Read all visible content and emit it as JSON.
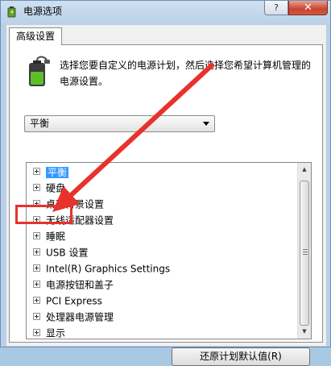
{
  "window": {
    "title": "电源选项",
    "help_label": "?",
    "close_label": "✕"
  },
  "tab": {
    "label": "高级设置"
  },
  "description": "选择您要自定义的电源计划，然后选择您希望计算机管理的电源设置。",
  "plan_select": {
    "value": "平衡"
  },
  "tree": {
    "items": [
      {
        "label": "平衡",
        "selected": true
      },
      {
        "label": "硬盘"
      },
      {
        "label": "桌面背景设置"
      },
      {
        "label": "无线适配器设置"
      },
      {
        "label": "睡眠"
      },
      {
        "label": "USB 设置"
      },
      {
        "label": "Intel(R) Graphics Settings"
      },
      {
        "label": "电源按钮和盖子"
      },
      {
        "label": "PCI Express"
      },
      {
        "label": "处理器电源管理"
      },
      {
        "label": "显示"
      }
    ]
  },
  "buttons": {
    "restore_label": "还原计划默认值(R)"
  },
  "annotation": {
    "color": "#e8322b"
  }
}
